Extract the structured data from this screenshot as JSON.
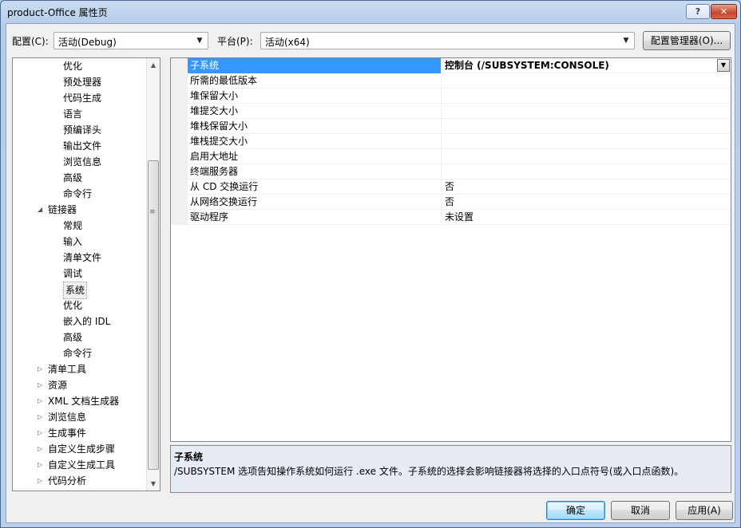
{
  "window": {
    "title": "product-Office 属性页",
    "help_label": "?",
    "close_label": "✕"
  },
  "toolbar": {
    "config_label": "配置(C):",
    "config_value": "活动(Debug)",
    "platform_label": "平台(P):",
    "platform_value": "活动(x64)",
    "config_manager_label": "配置管理器(O)..."
  },
  "tree": {
    "items": [
      {
        "label": "优化",
        "level": 2
      },
      {
        "label": "预处理器",
        "level": 2
      },
      {
        "label": "代码生成",
        "level": 2
      },
      {
        "label": "语言",
        "level": 2
      },
      {
        "label": "预编译头",
        "level": 2
      },
      {
        "label": "输出文件",
        "level": 2
      },
      {
        "label": "浏览信息",
        "level": 2
      },
      {
        "label": "高级",
        "level": 2
      },
      {
        "label": "命令行",
        "level": 2
      },
      {
        "label": "链接器",
        "level": 1,
        "expanded": true
      },
      {
        "label": "常规",
        "level": 2
      },
      {
        "label": "输入",
        "level": 2
      },
      {
        "label": "清单文件",
        "level": 2
      },
      {
        "label": "调试",
        "level": 2
      },
      {
        "label": "系统",
        "level": 2,
        "selected": true
      },
      {
        "label": "优化",
        "level": 2
      },
      {
        "label": "嵌入的 IDL",
        "level": 2
      },
      {
        "label": "高级",
        "level": 2
      },
      {
        "label": "命令行",
        "level": 2
      },
      {
        "label": "清单工具",
        "level": 1,
        "collapsed": true
      },
      {
        "label": "资源",
        "level": 1,
        "collapsed": true
      },
      {
        "label": "XML 文档生成器",
        "level": 1,
        "collapsed": true
      },
      {
        "label": "浏览信息",
        "level": 1,
        "collapsed": true
      },
      {
        "label": "生成事件",
        "level": 1,
        "collapsed": true
      },
      {
        "label": "自定义生成步骤",
        "level": 1,
        "collapsed": true
      },
      {
        "label": "自定义生成工具",
        "level": 1,
        "collapsed": true
      },
      {
        "label": "代码分析",
        "level": 1,
        "collapsed": true
      }
    ]
  },
  "properties": [
    {
      "name": "子系统",
      "value": "控制台 (/SUBSYSTEM:CONSOLE)",
      "selected": true
    },
    {
      "name": "所需的最低版本",
      "value": ""
    },
    {
      "name": "堆保留大小",
      "value": ""
    },
    {
      "name": "堆提交大小",
      "value": ""
    },
    {
      "name": "堆栈保留大小",
      "value": ""
    },
    {
      "name": "堆栈提交大小",
      "value": ""
    },
    {
      "name": "启用大地址",
      "value": ""
    },
    {
      "name": "终端服务器",
      "value": ""
    },
    {
      "name": "从 CD 交换运行",
      "value": "否"
    },
    {
      "name": "从网络交换运行",
      "value": "否"
    },
    {
      "name": "驱动程序",
      "value": "未设置"
    }
  ],
  "description": {
    "title": "子系统",
    "text": "/SUBSYSTEM 选项告知操作系统如何运行 .exe 文件。子系统的选择会影响链接器将选择的入口点符号(或入口点函数)。"
  },
  "buttons": {
    "ok": "确定",
    "cancel": "取消",
    "apply": "应用(A)"
  },
  "colors": {
    "selection": "#3399ff",
    "accent_border": "#3c7fb1"
  }
}
